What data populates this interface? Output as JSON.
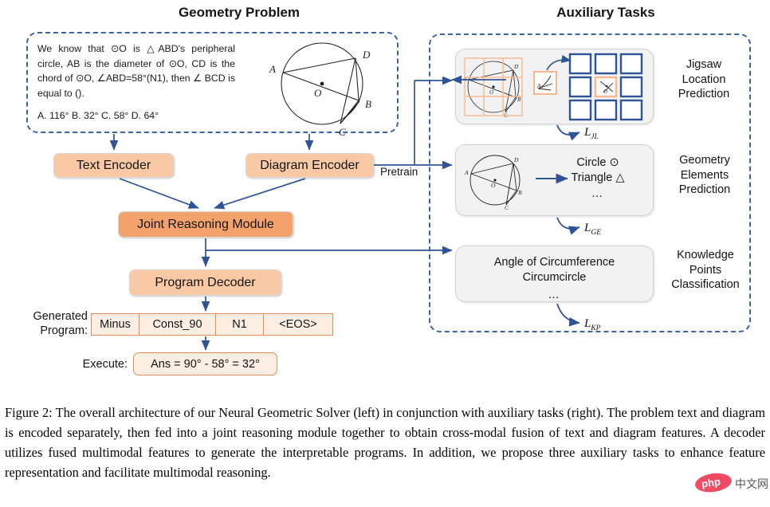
{
  "headers": {
    "left": "Geometry Problem",
    "right": "Auxiliary Tasks"
  },
  "problem": {
    "text": "We know that ⊙O is △ABD's peripheral circle, AB is the diameter of ⊙O, CD is the chord of ⊙O, ∠ABD=58°(N1), then ∠ BCD is equal to ().",
    "options": "A. 116°  B. 32°  C. 58°  D. 64°",
    "diagram_labels": {
      "A": "A",
      "B": "B",
      "C": "C",
      "D": "D",
      "O": "O"
    }
  },
  "pipeline": {
    "text_encoder": "Text Encoder",
    "diagram_encoder": "Diagram Encoder",
    "joint_module": "Joint Reasoning Module",
    "program_decoder": "Program Decoder",
    "pretrain_label": "Pretrain"
  },
  "program": {
    "label_line1": "Generated",
    "label_line2": "Program:",
    "tokens": [
      "Minus",
      "Const_90",
      "N1",
      "<EOS>"
    ],
    "execute_label": "Execute:",
    "execute_value": "Ans = 90° - 58° = 32°"
  },
  "tasks": [
    {
      "name": "jigsaw",
      "label_lines": [
        "Jigsaw",
        "Location",
        "Prediction"
      ],
      "loss": "L",
      "loss_sub": "JL"
    },
    {
      "name": "geometry-elements",
      "label_lines": [
        "Geometry",
        "Elements",
        "Prediction"
      ],
      "content_lines": [
        "Circle ⊙",
        "Triangle △",
        "…"
      ],
      "loss": "L",
      "loss_sub": "GE"
    },
    {
      "name": "knowledge-points",
      "label_lines": [
        "Knowledge",
        "Points",
        "Classification"
      ],
      "content_lines": [
        "Angle of Circumference",
        "Circumcircle",
        "…"
      ],
      "loss": "L",
      "loss_sub": "KP"
    }
  ],
  "caption": "Figure 2: The overall architecture of our Neural Geometric Solver (left) in conjunction with auxiliary tasks (right). The problem text and diagram is encoded separately, then fed into a joint reasoning module together to obtain cross-modal fusion of text and diagram features. A decoder utilizes fused multimodal features to generate the interpretable programs. In addition, we propose three auxiliary tasks to enhance feature representation and facilitate multimodal reasoning.",
  "watermark": {
    "badge": "php",
    "text": "中文网"
  },
  "colors": {
    "accent_blue": "#3a63a8",
    "box_light": "#f9c9a6",
    "box_deep": "#f4a26b",
    "token_fill": "#fdeee4",
    "token_border": "#e08e54",
    "card_bg": "#f2f2f2"
  }
}
